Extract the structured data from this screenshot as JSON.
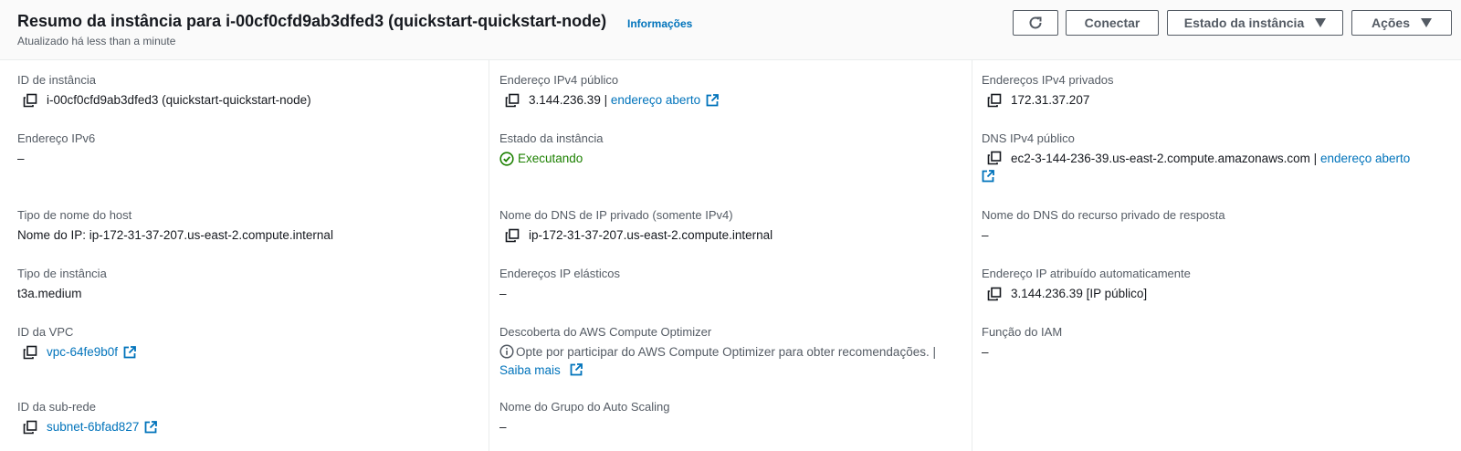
{
  "header": {
    "title": "Resumo da instância para i-00cf0cfd9ab3dfed3 (quickstart-quickstart-node)",
    "info_link": "Informações",
    "subtitle": "Atualizado há less than a minute",
    "buttons": {
      "refresh_icon": "refresh-icon",
      "connect": "Conectar",
      "instance_state": "Estado da instância",
      "actions": "Ações"
    }
  },
  "col1": {
    "instance_id": {
      "label": "ID de instância",
      "value": "i-00cf0cfd9ab3dfed3 (quickstart-quickstart-node)"
    },
    "ipv6": {
      "label": "Endereço IPv6",
      "value": "–"
    },
    "hostname_type": {
      "label": "Tipo de nome do host",
      "value": "Nome do IP: ip-172-31-37-207.us-east-2.compute.internal"
    },
    "instance_type": {
      "label": "Tipo de instância",
      "value": "t3a.medium"
    },
    "vpc_id": {
      "label": "ID da VPC",
      "value": "vpc-64fe9b0f"
    },
    "subnet_id": {
      "label": "ID da sub-rede",
      "value": "subnet-6bfad827"
    }
  },
  "col2": {
    "public_ipv4": {
      "label": "Endereço IPv4 público",
      "value": "3.144.236.39 |",
      "link": "endereço aberto"
    },
    "instance_state": {
      "label": "Estado da instância",
      "value": "Executando"
    },
    "private_dns": {
      "label": "Nome do DNS de IP privado (somente IPv4)",
      "value": "ip-172-31-37-207.us-east-2.compute.internal"
    },
    "elastic_ips": {
      "label": "Endereços IP elásticos",
      "value": "–"
    },
    "compute_optimizer": {
      "label": "Descoberta do AWS Compute Optimizer",
      "value": "Opte por participar do AWS Compute Optimizer para obter recomendações. |",
      "link": "Saiba mais"
    },
    "asg_name": {
      "label": "Nome do Grupo do Auto Scaling",
      "value": "–"
    }
  },
  "col3": {
    "private_ipv4": {
      "label": "Endereços IPv4 privados",
      "value": "172.31.37.207"
    },
    "public_dns": {
      "label": "DNS IPv4 público",
      "value": "ec2-3-144-236-39.us-east-2.compute.amazonaws.com |",
      "link": "endereço aberto"
    },
    "private_resource_dns": {
      "label": "Nome do DNS do recurso privado de resposta",
      "value": "–"
    },
    "auto_ip": {
      "label": "Endereço IP atribuído automaticamente",
      "value": "3.144.236.39 [IP público]"
    },
    "iam_role": {
      "label": "Função do IAM",
      "value": "–"
    }
  },
  "colors": {
    "link": "#0073bb",
    "success": "#1d8102",
    "label": "#545b64",
    "text": "#16191f"
  }
}
